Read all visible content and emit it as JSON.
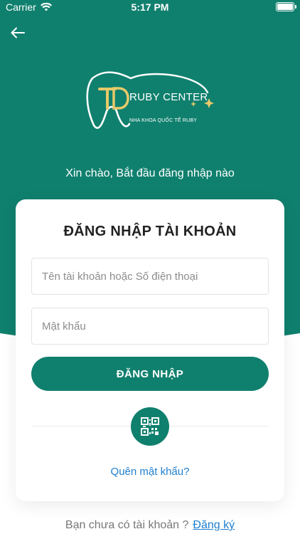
{
  "status_bar": {
    "carrier": "Carrier",
    "time": "5:17 PM"
  },
  "header": {
    "back_icon": "arrow-left-icon"
  },
  "logo": {
    "brand": "RUBY CENTER",
    "subtitle": "NHA KHOA QUỐC TẾ RUBY"
  },
  "greeting": "Xin chào, Bắt đầu đăng nhập nào",
  "login_card": {
    "title": "ĐĂNG NHẬP TÀI KHOẢN",
    "username_placeholder": "Tên tài khoản hoặc Số điện thoại",
    "username_value": "",
    "password_placeholder": "Mật khẩu",
    "password_value": "",
    "login_label": "ĐĂNG NHẬP",
    "qr_icon": "qr-code-icon",
    "forgot_label": "Quên mật khẩu?"
  },
  "signup": {
    "prompt": "Bạn chưa có tài khoản ?",
    "link_label": "Đăng ký"
  },
  "colors": {
    "primary": "#10806e",
    "link": "#1f7fd0"
  }
}
